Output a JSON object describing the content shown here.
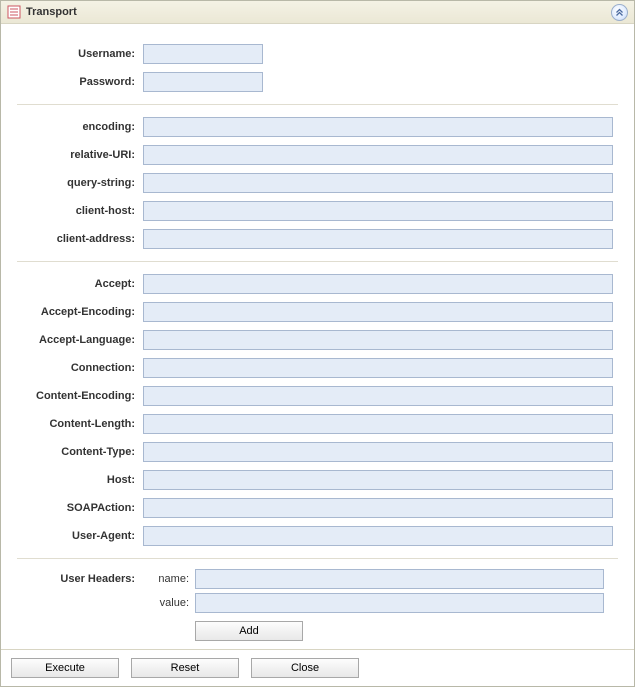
{
  "panel": {
    "title": "Transport"
  },
  "auth": {
    "username_label": "Username:",
    "username_value": "",
    "password_label": "Password:",
    "password_value": ""
  },
  "transport": {
    "encoding_label": "encoding:",
    "encoding_value": "",
    "relative_uri_label": "relative-URI:",
    "relative_uri_value": "",
    "query_string_label": "query-string:",
    "query_string_value": "",
    "client_host_label": "client-host:",
    "client_host_value": "",
    "client_address_label": "client-address:",
    "client_address_value": ""
  },
  "headers": {
    "accept_label": "Accept:",
    "accept_value": "",
    "accept_encoding_label": "Accept-Encoding:",
    "accept_encoding_value": "",
    "accept_language_label": "Accept-Language:",
    "accept_language_value": "",
    "connection_label": "Connection:",
    "connection_value": "",
    "content_encoding_label": "Content-Encoding:",
    "content_encoding_value": "",
    "content_length_label": "Content-Length:",
    "content_length_value": "",
    "content_type_label": "Content-Type:",
    "content_type_value": "",
    "host_label": "Host:",
    "host_value": "",
    "soap_action_label": "SOAPAction:",
    "soap_action_value": "",
    "user_agent_label": "User-Agent:",
    "user_agent_value": ""
  },
  "user_headers": {
    "section_label": "User Headers:",
    "name_label": "name:",
    "name_value": "",
    "value_label": "value:",
    "value_value": "",
    "add_label": "Add"
  },
  "buttons": {
    "execute": "Execute",
    "reset": "Reset",
    "close": "Close"
  }
}
